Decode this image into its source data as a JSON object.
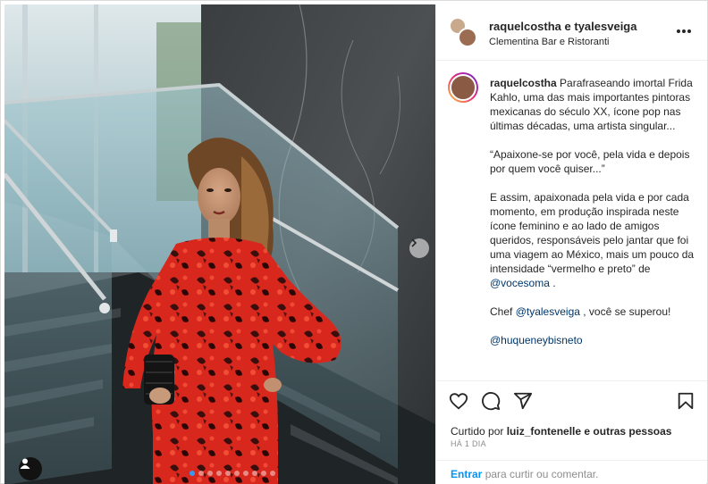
{
  "post": {
    "header": {
      "usernames": "raquelcostha e tyalesveiga",
      "location": "Clementina Bar e Ristoranti"
    },
    "caption": {
      "username": "raquelcostha",
      "para1": "Parafraseando imortal Frida Kahlo, uma das mais importantes pintoras mexicanas do século XX, ícone pop nas últimas décadas, uma artista singular...",
      "para2": "“Apaixone-se por você, pela vida e depois por quem você quiser...”",
      "para3": "E assim, apaixonada pela vida e por cada momento, em produção inspirada neste ícone feminino e ao lado de amigos queridos, responsáveis pelo jantar que foi uma viagem ao México, mais um pouco da intensidade “vermelho e preto” de",
      "mention1": "@vocesoma",
      "para3_end": ".",
      "chef_prefix": "Chef",
      "mention2": "@tyalesveiga",
      "chef_suffix": ", você se superou!",
      "mention3": "@huqueneybisneto"
    },
    "likes": {
      "prefix": "Curtido por",
      "user": "luiz_fontenelle",
      "suffix": "e outras pessoas"
    },
    "time": "HÁ 1 DIA",
    "login": {
      "link": "Entrar",
      "text": "para curtir ou comentar."
    },
    "carousel": {
      "count": 10,
      "active_index": 0
    },
    "icons": {
      "like": "heart-icon",
      "comment": "comment-icon",
      "share": "share-icon",
      "save": "bookmark-icon",
      "more": "more-icon",
      "next": "chevron-right-icon",
      "tags": "user-tag-icon"
    },
    "colors": {
      "link": "#00376b",
      "login_link": "#0095f6",
      "muted": "#8e8e8e",
      "dress": "#d8281e"
    }
  }
}
